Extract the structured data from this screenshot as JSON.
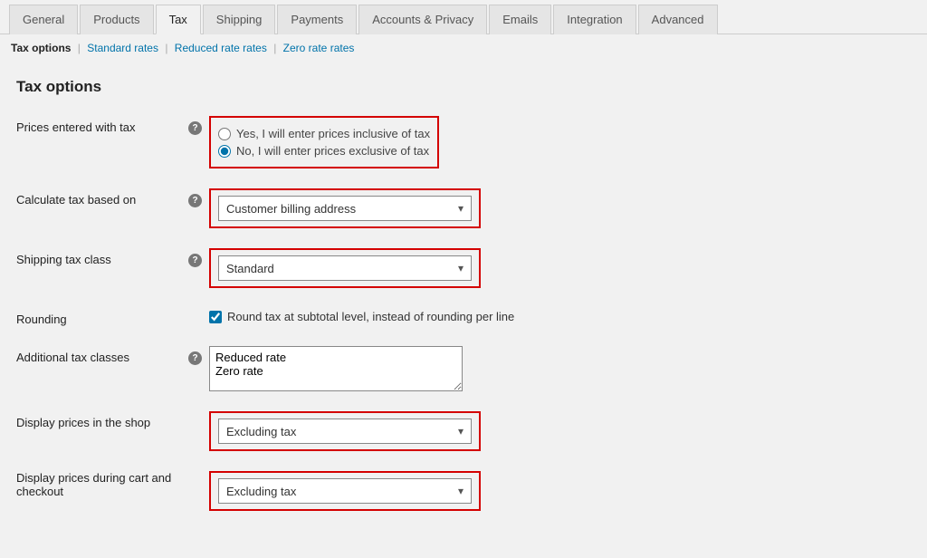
{
  "tabs": {
    "general": "General",
    "products": "Products",
    "tax": "Tax",
    "shipping": "Shipping",
    "payments": "Payments",
    "accounts": "Accounts & Privacy",
    "emails": "Emails",
    "integration": "Integration",
    "advanced": "Advanced",
    "active": "tax"
  },
  "subnav": {
    "current": "Tax options",
    "standard": "Standard rates",
    "reduced": "Reduced rate rates",
    "zero": "Zero rate rates"
  },
  "page_title": "Tax options",
  "rows": {
    "prices_entered": {
      "label": "Prices entered with tax",
      "option_inclusive": "Yes, I will enter prices inclusive of tax",
      "option_exclusive": "No, I will enter prices exclusive of tax",
      "selected": "exclusive"
    },
    "calc_based": {
      "label": "Calculate tax based on",
      "value": "Customer billing address"
    },
    "shipping_class": {
      "label": "Shipping tax class",
      "value": "Standard"
    },
    "rounding": {
      "label": "Rounding",
      "option": "Round tax at subtotal level, instead of rounding per line",
      "checked": true
    },
    "additional_classes": {
      "label": "Additional tax classes",
      "value": "Reduced rate\nZero rate"
    },
    "display_shop": {
      "label": "Display prices in the shop",
      "value": "Excluding tax"
    },
    "display_cart": {
      "label": "Display prices during cart and checkout",
      "value": "Excluding tax"
    }
  },
  "help_glyph": "?"
}
